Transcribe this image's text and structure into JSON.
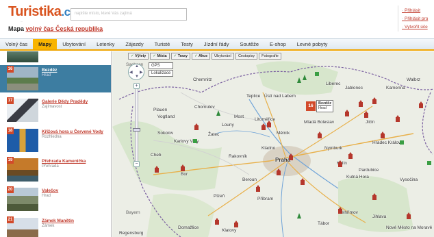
{
  "header": {
    "logo": "Turistika.cz",
    "logo_main": "Turistika",
    "logo_tld": ".cz",
    "logo_sub": "...",
    "search_placeholder": "napište místo, které Vás zajímá",
    "map_title_prefix": "Mapa",
    "map_title_link": "volný čas Česká republika",
    "user_links": [
      "Přihlásit",
      "Přihlásit pro",
      "Vytvořit úče"
    ]
  },
  "nav": {
    "items": [
      "Volný čas",
      "Mapy",
      "Ubytování",
      "Letenky",
      "Zájezdy",
      "Turisté",
      "Testy",
      "Jízdní řády",
      "Soutěže",
      "E-shop",
      "Levné pobyty"
    ],
    "active_index": 1
  },
  "sidebar": {
    "items": [
      {
        "num": "16",
        "name": "Bezděz",
        "type": "Hrad",
        "selected": true
      },
      {
        "num": "17",
        "name": "Galerie Dědy Pradědy",
        "type": "Zajímavost",
        "selected": false
      },
      {
        "num": "18",
        "name": "Křížová hora u Červené Vody",
        "type": "Rozhledna",
        "selected": false
      },
      {
        "num": "19",
        "name": "Přehrada Kamenička",
        "type": "Přehrada",
        "selected": false
      },
      {
        "num": "20",
        "name": "Valečov",
        "type": "Hrad",
        "selected": false
      },
      {
        "num": "21",
        "name": "Zámek Manětín",
        "type": "Zámek",
        "selected": false
      }
    ]
  },
  "map": {
    "filters": [
      {
        "label": "Výlety",
        "on": true
      },
      {
        "label": "Místa",
        "on": true
      },
      {
        "label": "Trasy",
        "on": true
      },
      {
        "label": "Akce",
        "on": true
      },
      {
        "label": "Ubytování",
        "on": false
      },
      {
        "label": "Cestopisy",
        "on": false
      },
      {
        "label": "Fotografie",
        "on": false
      }
    ],
    "gps_label": "GPS",
    "localize_label": "Lokalizace",
    "zoom_in": "+",
    "zoom_out": "−",
    "popup": {
      "num": "16",
      "name": "Bezděz",
      "type": "Hrad"
    },
    "cities": [
      "Chemnitz",
      "Plauen",
      "Vogtland",
      "Teplice",
      "Most",
      "Ústí nad Labem",
      "Liberec",
      "Karlovy Vary",
      "Cheb",
      "Kladno",
      "Praha",
      "Plzeň",
      "Nymburk",
      "Kolín",
      "Příbram",
      "Mladá Boleslav",
      "Hradec Králové",
      "Jihlava",
      "Tábor",
      "Domažlice",
      "Klatovy",
      "Kutná Hora",
      "Sokolov",
      "Rakovník",
      "Beroun",
      "Pardubice",
      "Jablonec",
      "Kamenna",
      "Walbrz",
      "Regensburg",
      "Nové Město na Moravě",
      "Pelhřimov",
      "Chomutov",
      "Louny",
      "Litoměřice",
      "Mělník",
      "Vysočina",
      "Bor",
      "Jičín",
      "Žatec"
    ],
    "country_labels": [
      "Bayern",
      "Sachsen"
    ]
  },
  "colors": {
    "accent": "#f8b400",
    "link": "#c0392b",
    "selected_row": "#3d7da1",
    "pin": "#b5372c"
  }
}
